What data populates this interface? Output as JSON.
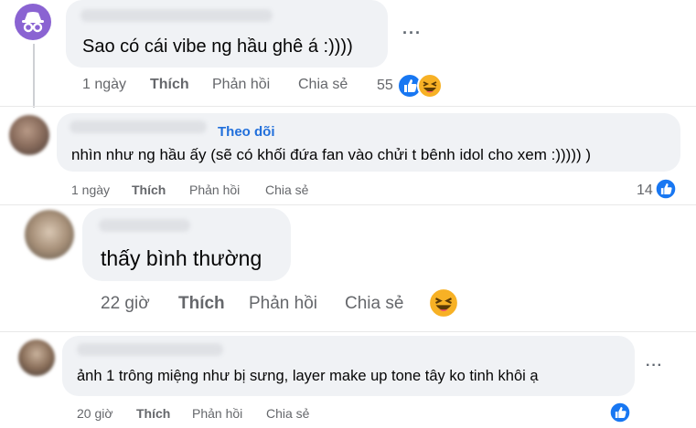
{
  "comments": [
    {
      "text": "Sao có cái vibe ng hầu ghê á :))))",
      "time": "1 ngày",
      "like_label": "Thích",
      "reply_label": "Phản hồi",
      "share_label": "Chia sẻ",
      "reaction_count": "55",
      "reaction_icons": [
        "like-icon",
        "haha-icon"
      ],
      "more_label": "···"
    },
    {
      "follow_label": "Theo dõi",
      "text": "nhìn như ng hầu ấy (sẽ có khối đứa fan vào chửi t bênh idol cho xem :))))) )",
      "time": "1 ngày",
      "like_label": "Thích",
      "reply_label": "Phản hồi",
      "share_label": "Chia sẻ",
      "reaction_count": "14",
      "reaction_icons": [
        "like-icon"
      ]
    },
    {
      "text": "thấy bình thường",
      "time": "22 giờ",
      "like_label": "Thích",
      "reply_label": "Phản hồi",
      "share_label": "Chia sẻ",
      "reaction_icons": [
        "haha-icon"
      ]
    },
    {
      "text": "ảnh 1 trông miệng như bị sưng, layer make up tone tây ko tinh khôi ạ",
      "time": "20 giờ",
      "like_label": "Thích",
      "reply_label": "Phản hồi",
      "share_label": "Chia sẻ",
      "reaction_icons": [
        "like-icon"
      ],
      "more_label": "···"
    }
  ],
  "colors": {
    "bubble": "#f0f2f5",
    "meta_text": "#65676b",
    "link_blue": "#216fdb",
    "like_blue": "#1877f2",
    "haha_yellow": "#f7b125",
    "anon_avatar": "#8a63d2"
  }
}
